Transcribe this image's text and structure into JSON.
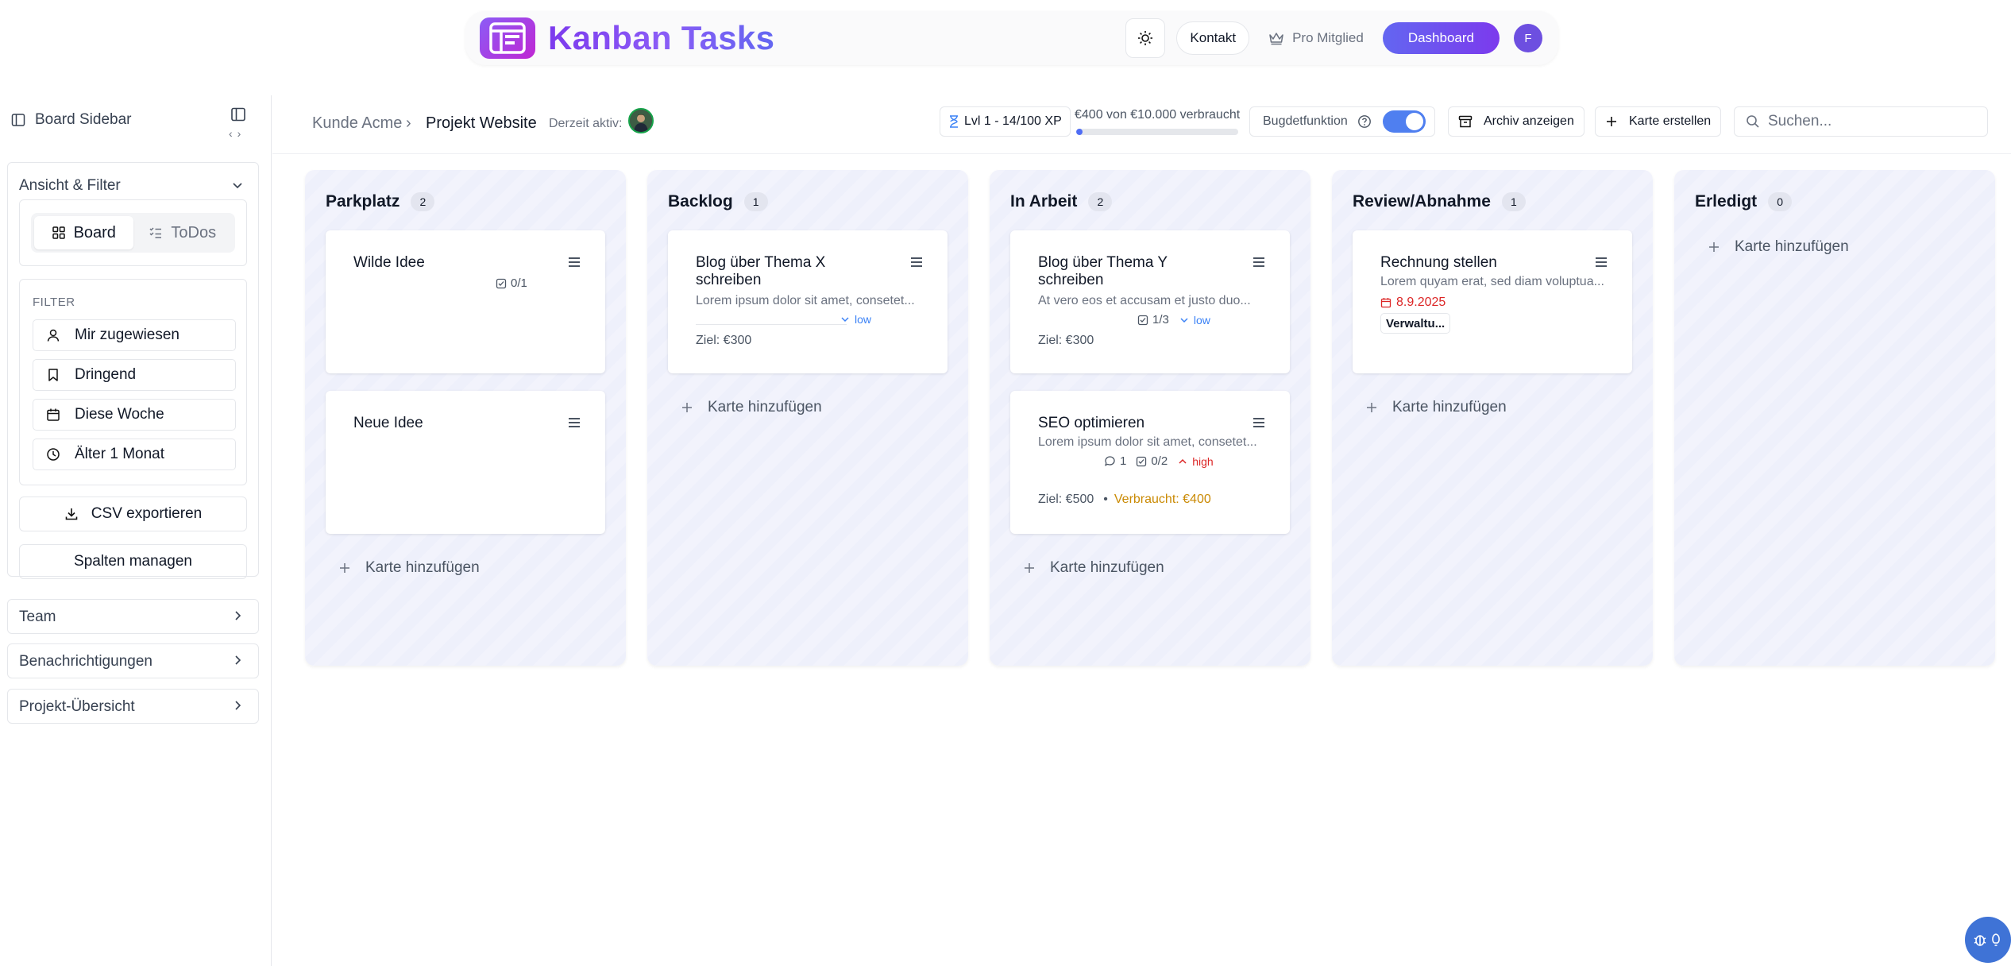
{
  "header": {
    "app_title": "Kanban Tasks",
    "contact_label": "Kontakt",
    "pro_label": "Pro Mitglied",
    "dashboard_label": "Dashboard",
    "avatar_initial": "F"
  },
  "sidebar": {
    "title": "Board Sidebar",
    "filter_section_title": "Ansicht & Filter",
    "views": [
      "Board",
      "ToDos"
    ],
    "filter_label": "FILTER",
    "filters": [
      "Mir zugewiesen",
      "Dringend",
      "Diese Woche",
      "Älter 1 Monat"
    ],
    "csv_label": "CSV exportieren",
    "columns_label": "Spalten managen",
    "sections": [
      "Team",
      "Benachrichtigungen",
      "Projekt-Übersicht"
    ]
  },
  "toolbar": {
    "breadcrumb": [
      "Kunde Acme",
      "Projekt Website"
    ],
    "active_label": "Derzeit aktiv:",
    "xp_label": "Lvl 1 - 14/100 XP",
    "budget_text": "€400 von €10.000 verbraucht",
    "budget_progress": 0.04,
    "budget_toggle_label": "Bugdetfunktion",
    "archive_label": "Archiv anzeigen",
    "create_card_label": "Karte erstellen",
    "search_placeholder": "Suchen..."
  },
  "board": {
    "add_card_label": "Karte hinzufügen",
    "columns": [
      {
        "title": "Parkplatz",
        "count": "2",
        "cards": [
          {
            "title": "Wilde Idee",
            "checklist": "0/1"
          },
          {
            "title": "Neue Idee"
          }
        ]
      },
      {
        "title": "Backlog",
        "count": "1",
        "cards": [
          {
            "title": "Blog über Thema X schreiben",
            "desc": "Lorem ipsum dolor sit amet, consetet...",
            "priority": "low",
            "goal": "Ziel: €300"
          }
        ]
      },
      {
        "title": "In Arbeit",
        "count": "2",
        "cards": [
          {
            "title": "Blog über Thema Y schreiben",
            "desc": "At vero eos et accusam et justo duo...",
            "checklist": "1/3",
            "priority": "low",
            "goal": "Ziel: €300"
          },
          {
            "title": "SEO optimieren",
            "desc": "Lorem ipsum dolor sit amet, consetet...",
            "comments": "1",
            "checklist": "0/2",
            "priority": "high",
            "goal": "Ziel: €500",
            "spent": "Verbraucht: €400"
          }
        ]
      },
      {
        "title": "Review/Abnahme",
        "count": "1",
        "cards": [
          {
            "title": "Rechnung stellen",
            "desc": "Lorem quyam erat, sed diam voluptua...",
            "date": "8.9.2025",
            "tag": "Verwaltu..."
          }
        ]
      },
      {
        "title": "Erledigt",
        "count": "0",
        "cards": []
      }
    ]
  },
  "colors": {
    "accent": "#6366f1",
    "brand_purple": "#7c3aed",
    "toggle_on": "#4f7ff0",
    "priority_low": "#3b82f6",
    "priority_high": "#dc2626",
    "spent": "#ca8a04"
  }
}
